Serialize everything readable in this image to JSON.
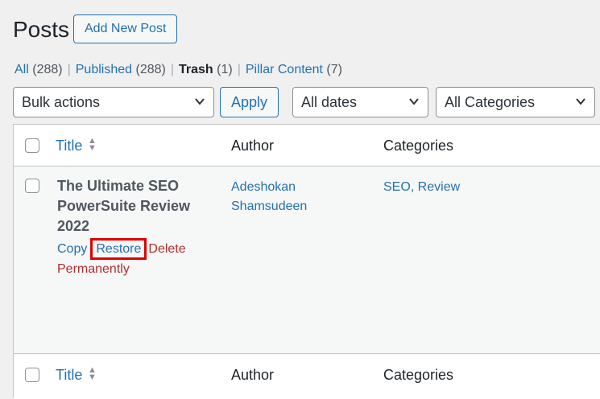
{
  "header": {
    "title": "Posts",
    "add_new_label": "Add New Post"
  },
  "filters": {
    "all": {
      "label": "All",
      "count": "(288)"
    },
    "published": {
      "label": "Published",
      "count": "(288)"
    },
    "trash": {
      "label": "Trash",
      "count": "(1)"
    },
    "pillar": {
      "label": "Pillar Content",
      "count": "(7)"
    },
    "separator": "|"
  },
  "toolbar": {
    "bulk_actions": "Bulk actions",
    "apply_label": "Apply",
    "dates": "All dates",
    "categories": "All Categories",
    "chevron": "❯"
  },
  "columns": {
    "title": "Title",
    "author": "Author",
    "categories": "Categories"
  },
  "row": {
    "title": "The Ultimate SEO PowerSuite Review 2022",
    "copy": "Copy",
    "restore": "Restore",
    "delete": "Delete Permanently",
    "author": "Adeshokan Shamsudeen",
    "categories": "SEO, Review"
  },
  "icons": {
    "sort": "sort-arrows-icon",
    "chevron": "chevron-down-icon"
  },
  "colors": {
    "link": "#2271b1",
    "delete": "#b32d2e",
    "highlight": "#e00000"
  }
}
